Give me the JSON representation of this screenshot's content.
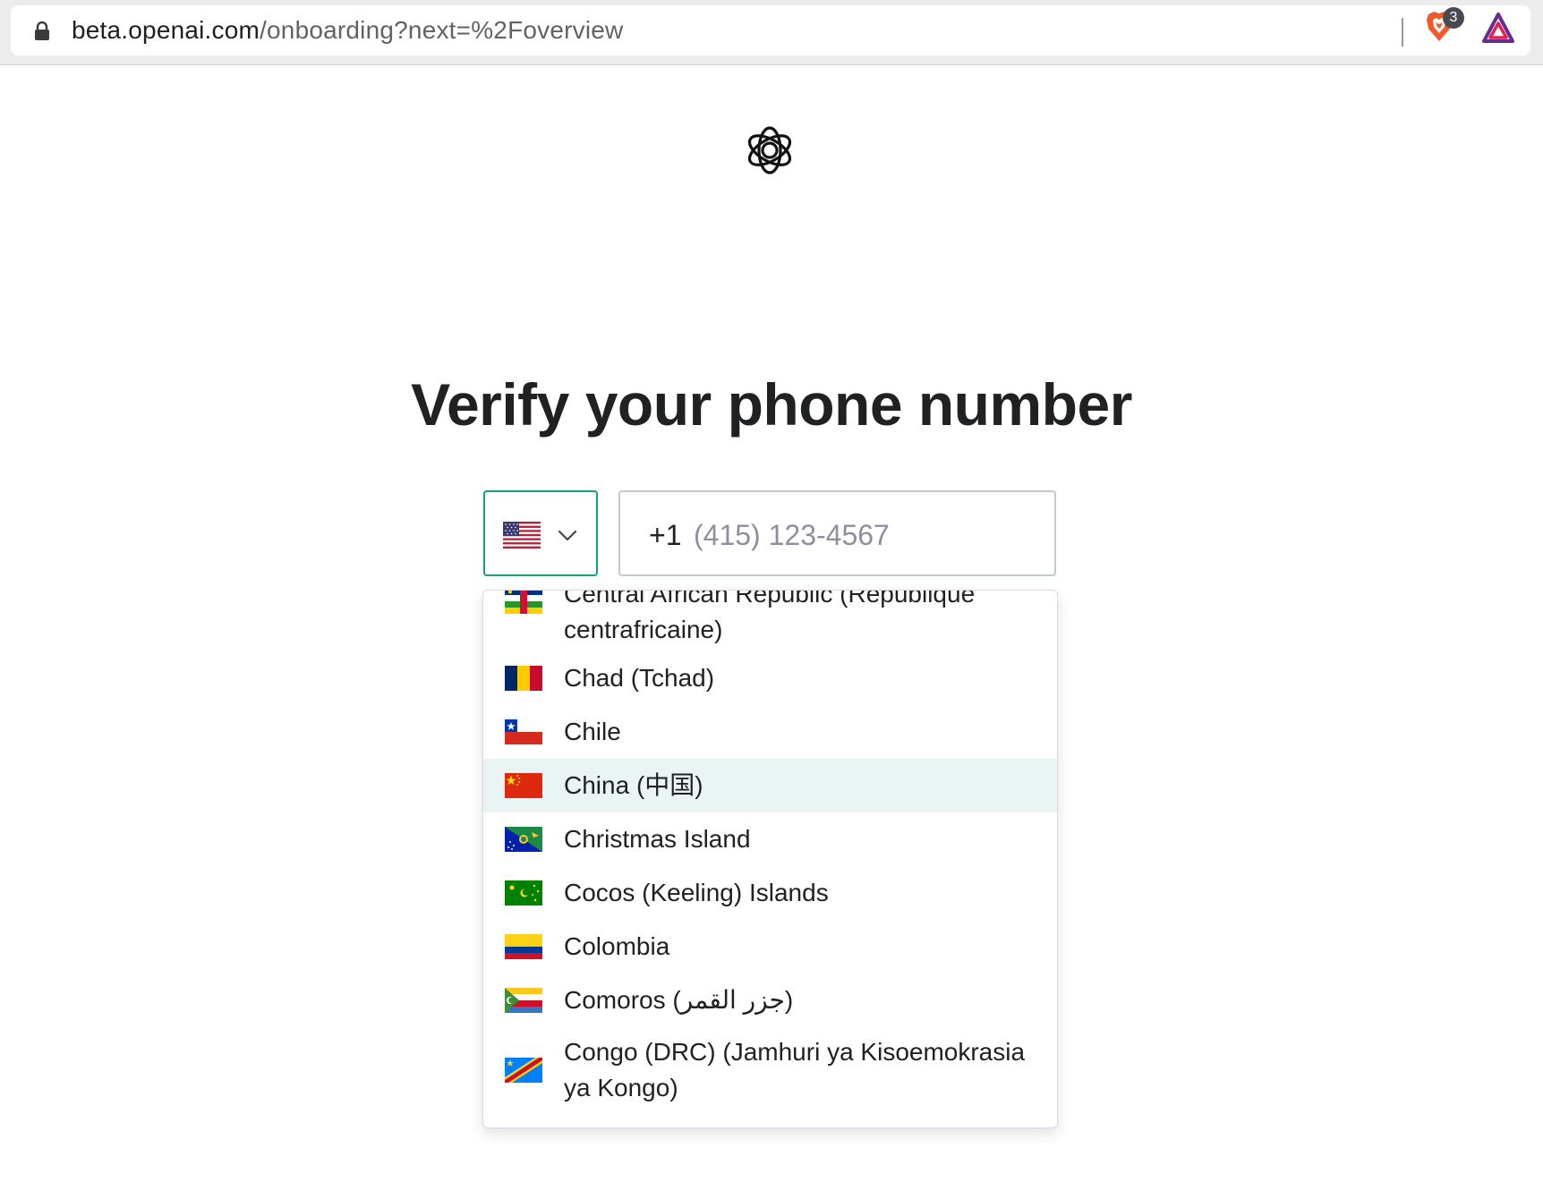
{
  "browser": {
    "url_host": "beta.openai.com",
    "url_path": "/onboarding?next=%2Foverview",
    "shield_count": "3"
  },
  "page": {
    "title": "Verify your phone number"
  },
  "phone": {
    "selected_country_flag": "us-flag",
    "dial_code": "+1",
    "placeholder": "(415) 123-4567",
    "value": ""
  },
  "dropdown": {
    "items": [
      {
        "label": "Central African Republic (République centrafricaine)",
        "flag": "cf-flag"
      },
      {
        "label": "Chad (Tchad)",
        "flag": "td-flag"
      },
      {
        "label": "Chile",
        "flag": "cl-flag"
      },
      {
        "label": "China (中国)",
        "flag": "cn-flag",
        "highlighted": true
      },
      {
        "label": "Christmas Island",
        "flag": "cx-flag"
      },
      {
        "label": "Cocos (Keeling) Islands",
        "flag": "cc-flag"
      },
      {
        "label": "Colombia",
        "flag": "co-flag"
      },
      {
        "label": "Comoros (‫جزر القمر‬‎)",
        "flag": "km-flag"
      },
      {
        "label": "Congo (DRC) (Jamhuri ya Kisoemokrasia ya Kongo)",
        "flag": "cd-flag"
      }
    ]
  },
  "colors": {
    "accent": "#10a37f",
    "highlight_row": "#eaf4f4",
    "text": "#202123",
    "placeholder": "#8e8ea0"
  }
}
